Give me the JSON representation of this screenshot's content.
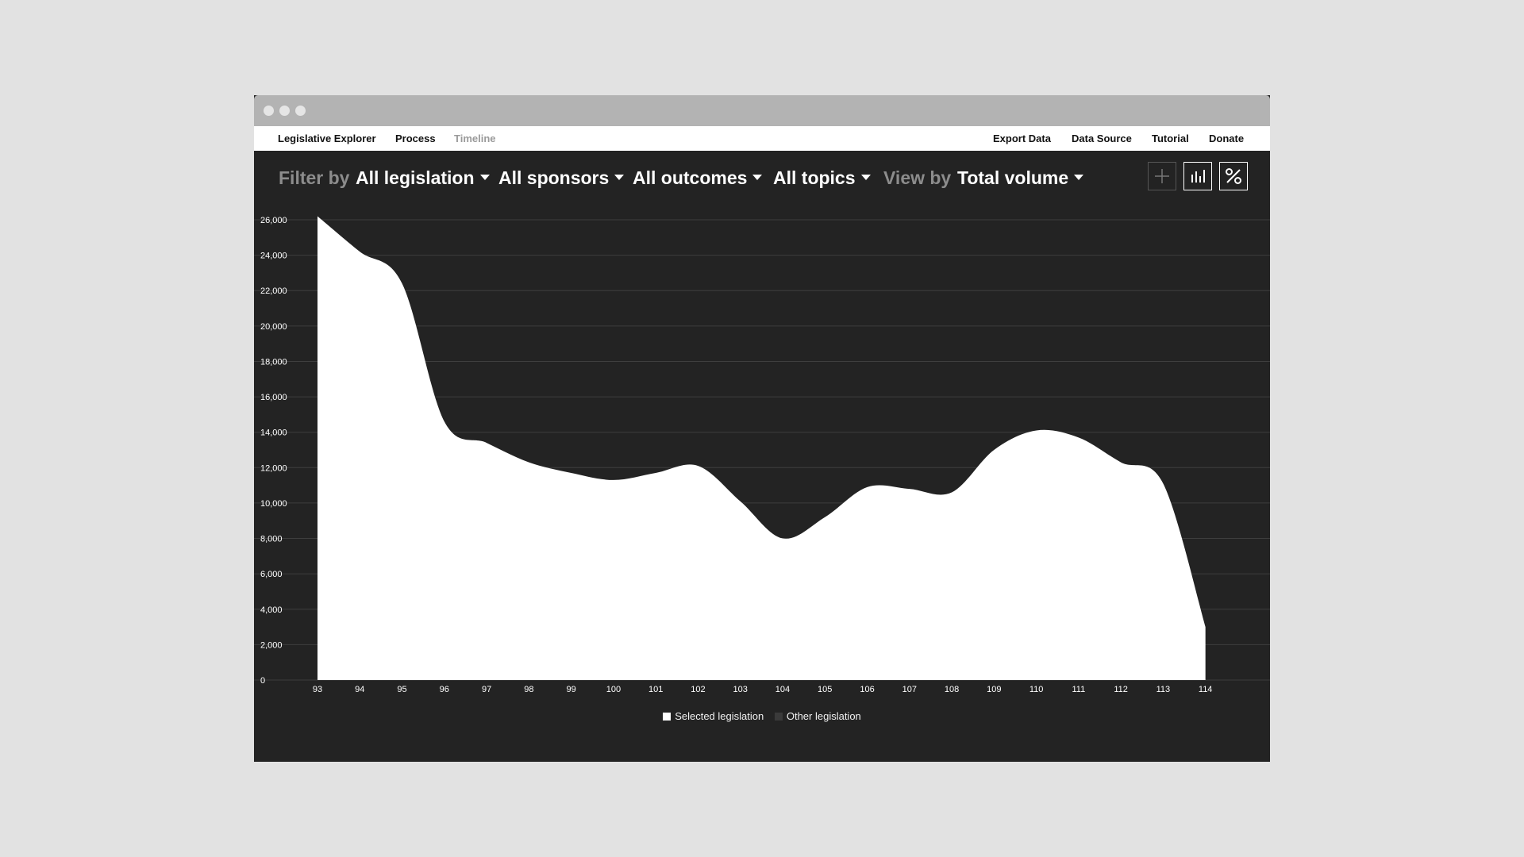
{
  "nav": {
    "left": [
      "Legislative Explorer",
      "Process",
      "Timeline"
    ],
    "right": [
      "Export Data",
      "Data Source",
      "Tutorial",
      "Donate"
    ]
  },
  "filters": {
    "filter_label": "Filter by",
    "legislation": "All legislation",
    "sponsors": "All sponsors",
    "outcomes": "All outcomes",
    "topics": "All topics",
    "view_label": "View by",
    "view": "Total volume"
  },
  "view_buttons": [
    {
      "icon": "plus-icon",
      "active": false
    },
    {
      "icon": "bar-chart-icon",
      "active": true
    },
    {
      "icon": "percent-icon",
      "active": true
    }
  ],
  "colors": {
    "background": "#232323",
    "selected": "#ffffff",
    "other": "#3a3a3a",
    "grid": "#3e3e3e",
    "axis_text": "#ffffff"
  },
  "chart_data": {
    "type": "area",
    "x": [
      "93",
      "94",
      "95",
      "96",
      "97",
      "98",
      "99",
      "100",
      "101",
      "102",
      "103",
      "104",
      "105",
      "106",
      "107",
      "108",
      "109",
      "110",
      "111",
      "112",
      "113",
      "114"
    ],
    "series": [
      {
        "name": "Selected legislation",
        "values": [
          26200,
          24200,
          22400,
          14600,
          13400,
          12300,
          11700,
          11300,
          11700,
          12100,
          10100,
          8000,
          9200,
          10900,
          10800,
          10600,
          13000,
          14100,
          13700,
          12300,
          11100,
          3000
        ]
      }
    ],
    "legend": [
      "Selected legislation",
      "Other legislation"
    ],
    "legend_position": "bottom-center",
    "yticks": [
      0,
      2000,
      4000,
      6000,
      8000,
      10000,
      12000,
      14000,
      16000,
      18000,
      20000,
      22000,
      24000,
      26000
    ],
    "ylim": [
      0,
      26000
    ],
    "grid": true,
    "xlabel": "",
    "ylabel": ""
  }
}
